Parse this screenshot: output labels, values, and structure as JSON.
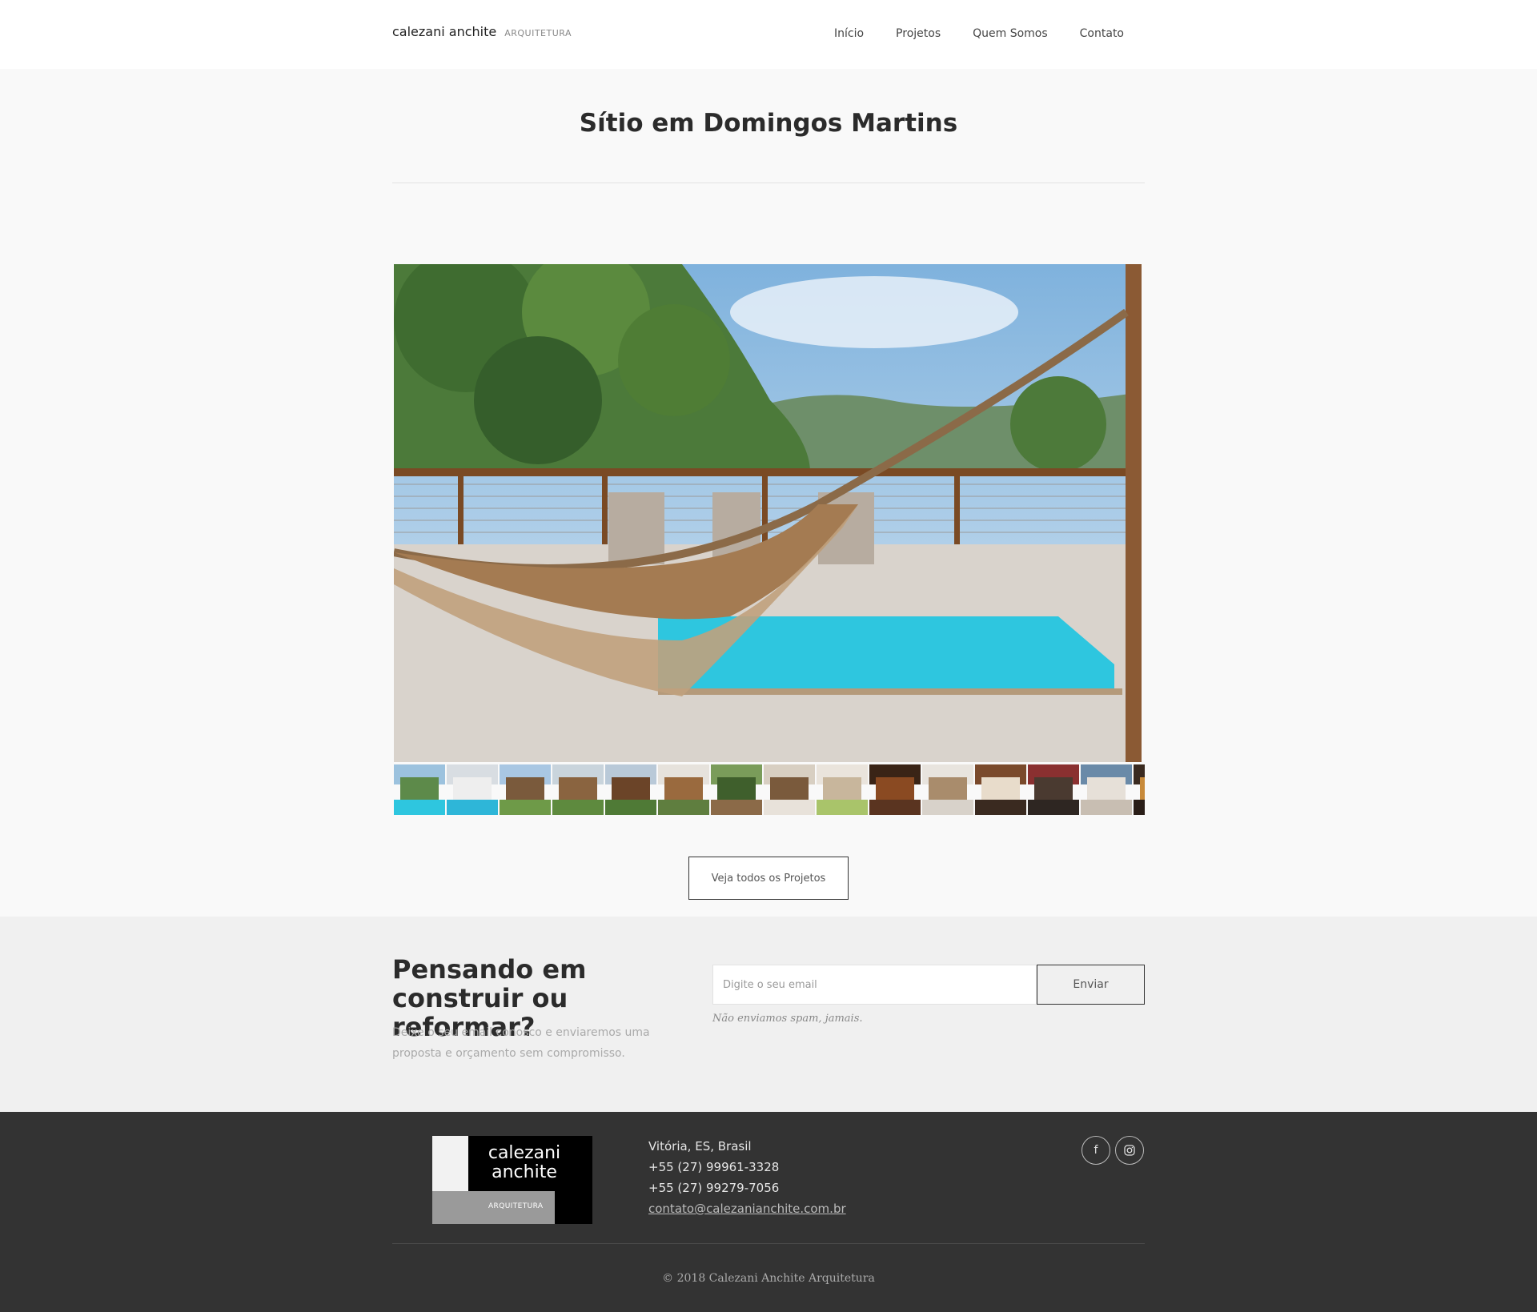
{
  "header": {
    "brand_name": "calezani anchite",
    "brand_sub": "ARQUITETURA",
    "nav": [
      "Início",
      "Projetos",
      "Quem Somos",
      "Contato"
    ]
  },
  "project": {
    "title": "Sítio em Domingos Martins"
  },
  "gallery": {
    "thumb_count": 15
  },
  "cta": {
    "all_projects_label": "Veja todos os Projetos"
  },
  "newsletter": {
    "heading": "Pensando em construir ou reformar?",
    "text": "Deixe o seu email conosco e enviaremos uma proposta e orçamento sem compromisso.",
    "placeholder": "Digite o seu email",
    "button": "Enviar",
    "note": "Não enviamos spam, jamais."
  },
  "footer": {
    "logo_name": "calezani anchite",
    "logo_sub": "ARQUITETURA",
    "city": "Vitória, ES, Brasil",
    "phone1": "+55 (27) 99961-3328",
    "phone2": "+55 (27) 99279-7056",
    "email": "contato@calezanianchite.com.br",
    "social_icons": [
      "facebook-icon",
      "instagram-icon"
    ],
    "copyright": "© 2018 Calezani Anchite Arquitetura"
  },
  "colors": {
    "page_bg": "#f9f9f9",
    "newsletter_bg": "#f0f0f0",
    "footer_bg": "#333333",
    "pool": "#2ec6df"
  }
}
